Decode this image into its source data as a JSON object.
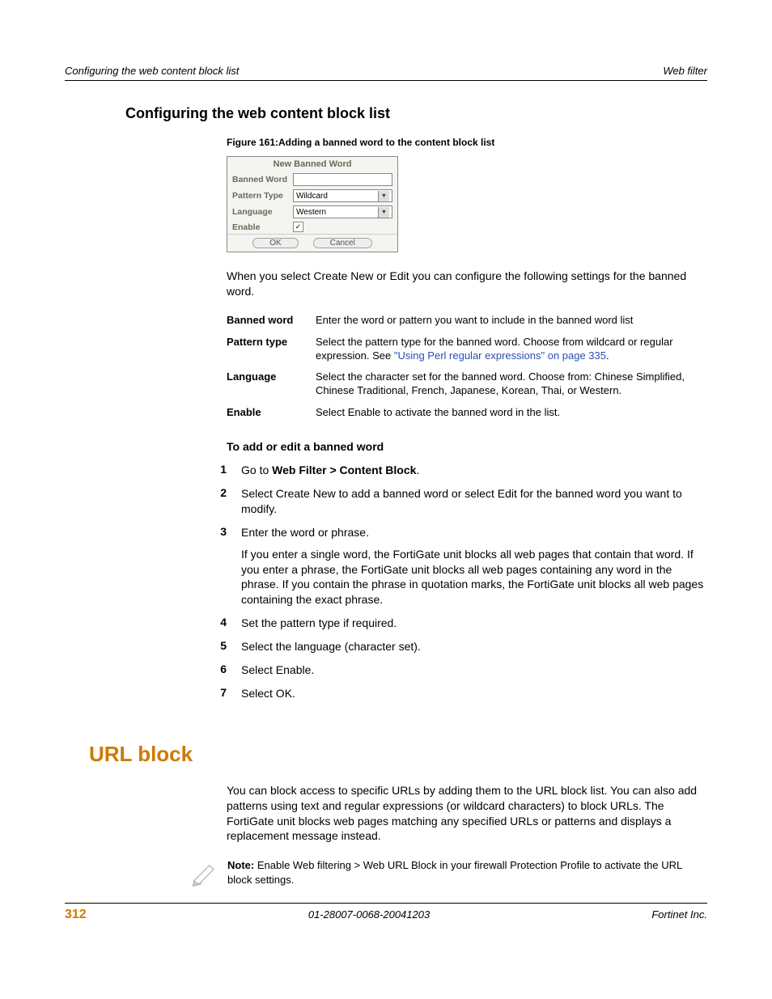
{
  "header": {
    "left": "Configuring the web content block list",
    "right": "Web filter"
  },
  "section1_title": "Configuring the web content block list",
  "figure": {
    "caption": "Figure 161:Adding a banned word to the content block list",
    "title": "New Banned Word",
    "rows": {
      "banned_word": {
        "label": "Banned Word",
        "value": ""
      },
      "pattern_type": {
        "label": "Pattern Type",
        "value": "Wildcard"
      },
      "language": {
        "label": "Language",
        "value": "Western"
      },
      "enable": {
        "label": "Enable",
        "checked": "✓"
      }
    },
    "ok": "OK",
    "cancel": "Cancel"
  },
  "intro_p": "When you select Create New or Edit you can configure the following settings for the banned word.",
  "defs": [
    {
      "term": "Banned word",
      "desc_a": "Enter the word or pattern you want to include in the banned word list"
    },
    {
      "term": "Pattern type",
      "desc_a": "Select the pattern type for the banned word. Choose from wildcard or regular expression. See ",
      "link": "\"Using Perl regular expressions\" on page 335",
      "desc_b": "."
    },
    {
      "term": "Language",
      "desc_a": "Select the character set for the banned word. Choose from: Chinese Simplified, Chinese Traditional, French, Japanese, Korean, Thai, or Western."
    },
    {
      "term": "Enable",
      "desc_a": "Select Enable to activate the banned word in the list."
    }
  ],
  "sub_heading": "To add or edit a banned word",
  "steps": [
    {
      "n": "1",
      "pre": "Go to ",
      "bold": "Web Filter > Content Block",
      "post": "."
    },
    {
      "n": "2",
      "text": "Select Create New to add a banned word or select Edit for the banned word you want to modify."
    },
    {
      "n": "3",
      "text": "Enter the word or phrase.",
      "extra": "If you enter a single word, the FortiGate unit blocks all web pages that contain that word. If you enter a phrase, the FortiGate unit blocks all web pages containing any word in the phrase. If you contain the phrase in quotation marks, the FortiGate unit blocks all web pages containing the exact phrase."
    },
    {
      "n": "4",
      "text": "Set the pattern type if required."
    },
    {
      "n": "5",
      "text": "Select the language (character set)."
    },
    {
      "n": "6",
      "text": "Select Enable."
    },
    {
      "n": "7",
      "text": "Select OK."
    }
  ],
  "major": "URL block",
  "url_p": "You can block access to specific URLs by adding them to the URL block list. You can also add patterns using text and regular expressions (or wildcard characters) to block URLs. The FortiGate unit blocks web pages matching any specified URLs or patterns and displays a replacement message instead.",
  "note_bold": "Note: ",
  "note_text": "Enable Web filtering > Web URL Block in your firewall Protection Profile to activate the URL block settings.",
  "footer": {
    "page": "312",
    "mid": "01-28007-0068-20041203",
    "right": "Fortinet Inc."
  }
}
